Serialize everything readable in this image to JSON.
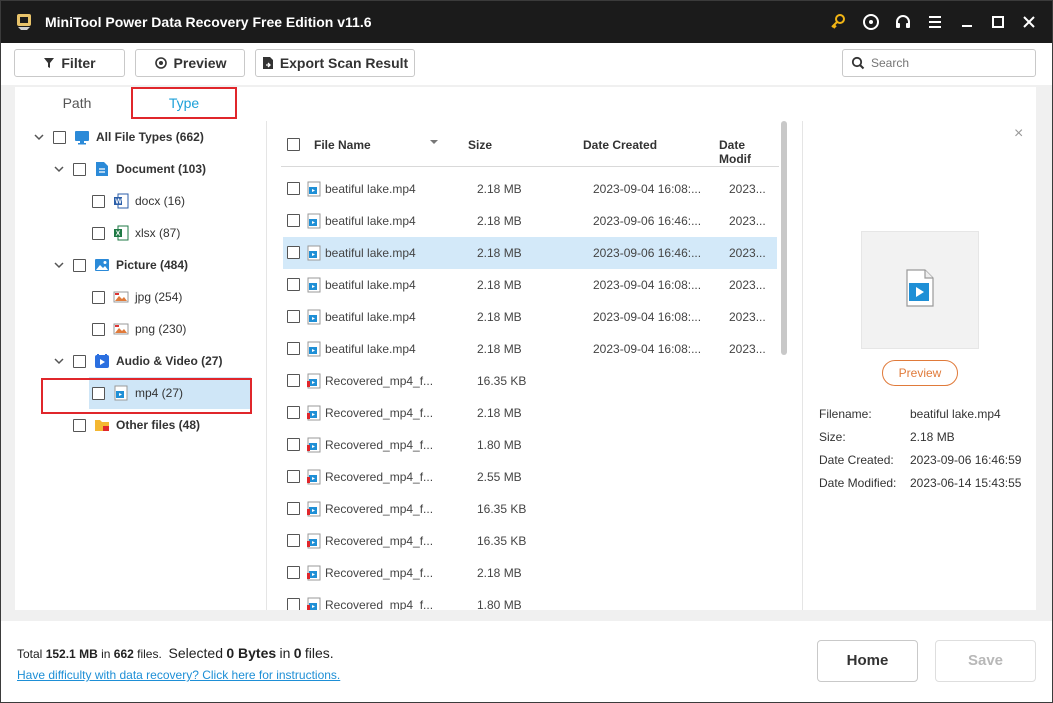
{
  "window": {
    "title": "MiniTool Power Data Recovery Free Edition v11.6"
  },
  "title_icons": [
    "key-icon",
    "disc-icon",
    "headset-icon",
    "menu-icon",
    "minimize-icon",
    "maximize-icon",
    "close-icon"
  ],
  "toolbar": {
    "filter_label": "Filter",
    "preview_label": "Preview",
    "export_label": "Export Scan Result",
    "search_placeholder": "Search"
  },
  "tabs": {
    "path": "Path",
    "type": "Type"
  },
  "tree": [
    {
      "label": "All File Types (662)",
      "icon": "monitor-icon",
      "bold": true
    },
    {
      "label": "Document (103)",
      "icon": "document-icon",
      "bold": true
    },
    {
      "label": "docx (16)",
      "icon": "word-icon",
      "bold": false
    },
    {
      "label": "xlsx (87)",
      "icon": "excel-icon",
      "bold": false
    },
    {
      "label": "Picture (484)",
      "icon": "picture-icon",
      "bold": true
    },
    {
      "label": "jpg (254)",
      "icon": "image-file-icon",
      "bold": false
    },
    {
      "label": "png (230)",
      "icon": "image-file-icon",
      "bold": false
    },
    {
      "label": "Audio & Video (27)",
      "icon": "media-icon",
      "bold": true
    },
    {
      "label": "mp4 (27)",
      "icon": "video-file-icon",
      "bold": false
    },
    {
      "label": "Other files (48)",
      "icon": "folder-icon",
      "bold": true
    }
  ],
  "filelist": {
    "headers": {
      "name": "File Name",
      "size": "Size",
      "created": "Date Created",
      "modified": "Date Modif"
    },
    "rows": [
      {
        "name": "beatiful lake.mp4",
        "size": "2.18 MB",
        "created": "2023-09-04 16:08:...",
        "modified": "2023..."
      },
      {
        "name": "beatiful lake.mp4",
        "size": "2.18 MB",
        "created": "2023-09-06 16:46:...",
        "modified": "2023..."
      },
      {
        "name": "beatiful lake.mp4",
        "size": "2.18 MB",
        "created": "2023-09-06 16:46:...",
        "modified": "2023..."
      },
      {
        "name": "beatiful lake.mp4",
        "size": "2.18 MB",
        "created": "2023-09-04 16:08:...",
        "modified": "2023..."
      },
      {
        "name": "beatiful lake.mp4",
        "size": "2.18 MB",
        "created": "2023-09-04 16:08:...",
        "modified": "2023..."
      },
      {
        "name": "beatiful lake.mp4",
        "size": "2.18 MB",
        "created": "2023-09-04 16:08:...",
        "modified": "2023..."
      },
      {
        "name": "Recovered_mp4_f...",
        "size": "16.35 KB",
        "created": "",
        "modified": ""
      },
      {
        "name": "Recovered_mp4_f...",
        "size": "2.18 MB",
        "created": "",
        "modified": ""
      },
      {
        "name": "Recovered_mp4_f...",
        "size": "1.80 MB",
        "created": "",
        "modified": ""
      },
      {
        "name": "Recovered_mp4_f...",
        "size": "2.55 MB",
        "created": "",
        "modified": ""
      },
      {
        "name": "Recovered_mp4_f...",
        "size": "16.35 KB",
        "created": "",
        "modified": ""
      },
      {
        "name": "Recovered_mp4_f...",
        "size": "16.35 KB",
        "created": "",
        "modified": ""
      },
      {
        "name": "Recovered_mp4_f...",
        "size": "2.18 MB",
        "created": "",
        "modified": ""
      },
      {
        "name": "Recovered_mp4_f...",
        "size": "1.80 MB",
        "created": "",
        "modified": ""
      }
    ]
  },
  "preview": {
    "button_label": "Preview",
    "fields": [
      {
        "key": "Filename:",
        "value": "beatiful lake.mp4"
      },
      {
        "key": "Size:",
        "value": "2.18 MB"
      },
      {
        "key": "Date Created:",
        "value": "2023-09-06 16:46:59"
      },
      {
        "key": "Date Modified:",
        "value": "2023-06-14 15:43:55"
      }
    ]
  },
  "footer": {
    "total_prefix": "Total",
    "total_size": "152.1 MB",
    "in_1": "in",
    "total_files": "662",
    "files_1": "files.",
    "selected_prefix": "Selected",
    "selected_size": "0 Bytes",
    "in_2": "in",
    "selected_files": "0",
    "files_2": "files.",
    "help_link": "Have difficulty with data recovery? Click here for instructions.",
    "home_label": "Home",
    "save_label": "Save"
  },
  "colors": {
    "accent": "#1ea0d8",
    "highlight_box": "#e0262b",
    "preview_button": "#e07a3a",
    "selected_row": "#d3e9f9"
  }
}
